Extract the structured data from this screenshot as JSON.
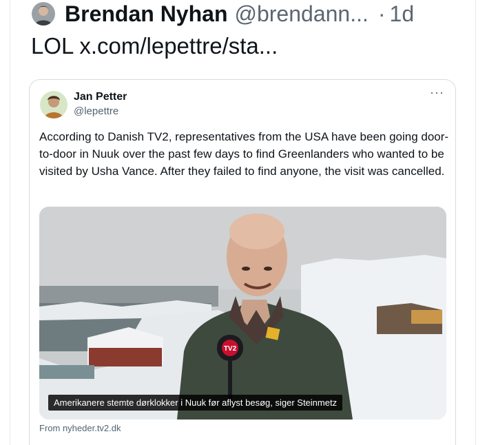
{
  "post": {
    "author_name": "Brendan Nyhan",
    "author_handle": "@brendann...",
    "separator": "·",
    "time": "1d",
    "text_prefix": "LOL",
    "link_text": "x.com/lepettre/sta..."
  },
  "quoted_post": {
    "author_name": "Jan Petter",
    "author_handle": "@lepettre",
    "more_label": "···",
    "text": "According to Danish TV2, representatives from the USA have been going door-to-door in Nuuk over the past few days to find Greenlanders who wanted to be visited by Usha Vance. After they failed to find anyone, the visit was cancelled.",
    "media": {
      "caption": "Amerikanere stemte dørklokker i Nuuk før aflyst besøg, siger Steinmetz",
      "microphone_logo": "TV2"
    },
    "source_label": "From nyheder.tv2.dk"
  },
  "colors": {
    "text": "#0f1419",
    "muted": "#536471",
    "border": "#d6dbe0",
    "tv2_red": "#c8102e"
  },
  "icons": {
    "more": "ellipsis-icon"
  }
}
